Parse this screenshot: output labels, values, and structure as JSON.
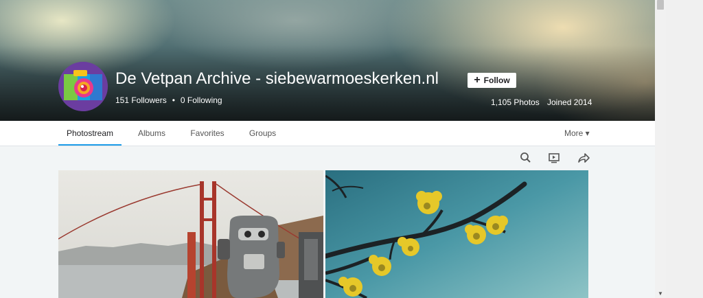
{
  "profile": {
    "title": "De Vetpan Archive - siebewarmoeskerken.nl",
    "follow_label": "Follow",
    "followers": "151 Followers",
    "following": "0 Following",
    "separator": "•",
    "photos": "1,105 Photos",
    "joined": "Joined 2014"
  },
  "nav": {
    "tabs": [
      {
        "label": "Photostream",
        "active": true
      },
      {
        "label": "Albums",
        "active": false
      },
      {
        "label": "Favorites",
        "active": false
      },
      {
        "label": "Groups",
        "active": false
      }
    ],
    "more_label": "More ▾"
  },
  "toolbar": {
    "icons": [
      "search-icon",
      "slideshow-icon",
      "share-icon"
    ]
  },
  "colors": {
    "accent": "#1c9be9",
    "page_bg": "#f2f5f6"
  }
}
